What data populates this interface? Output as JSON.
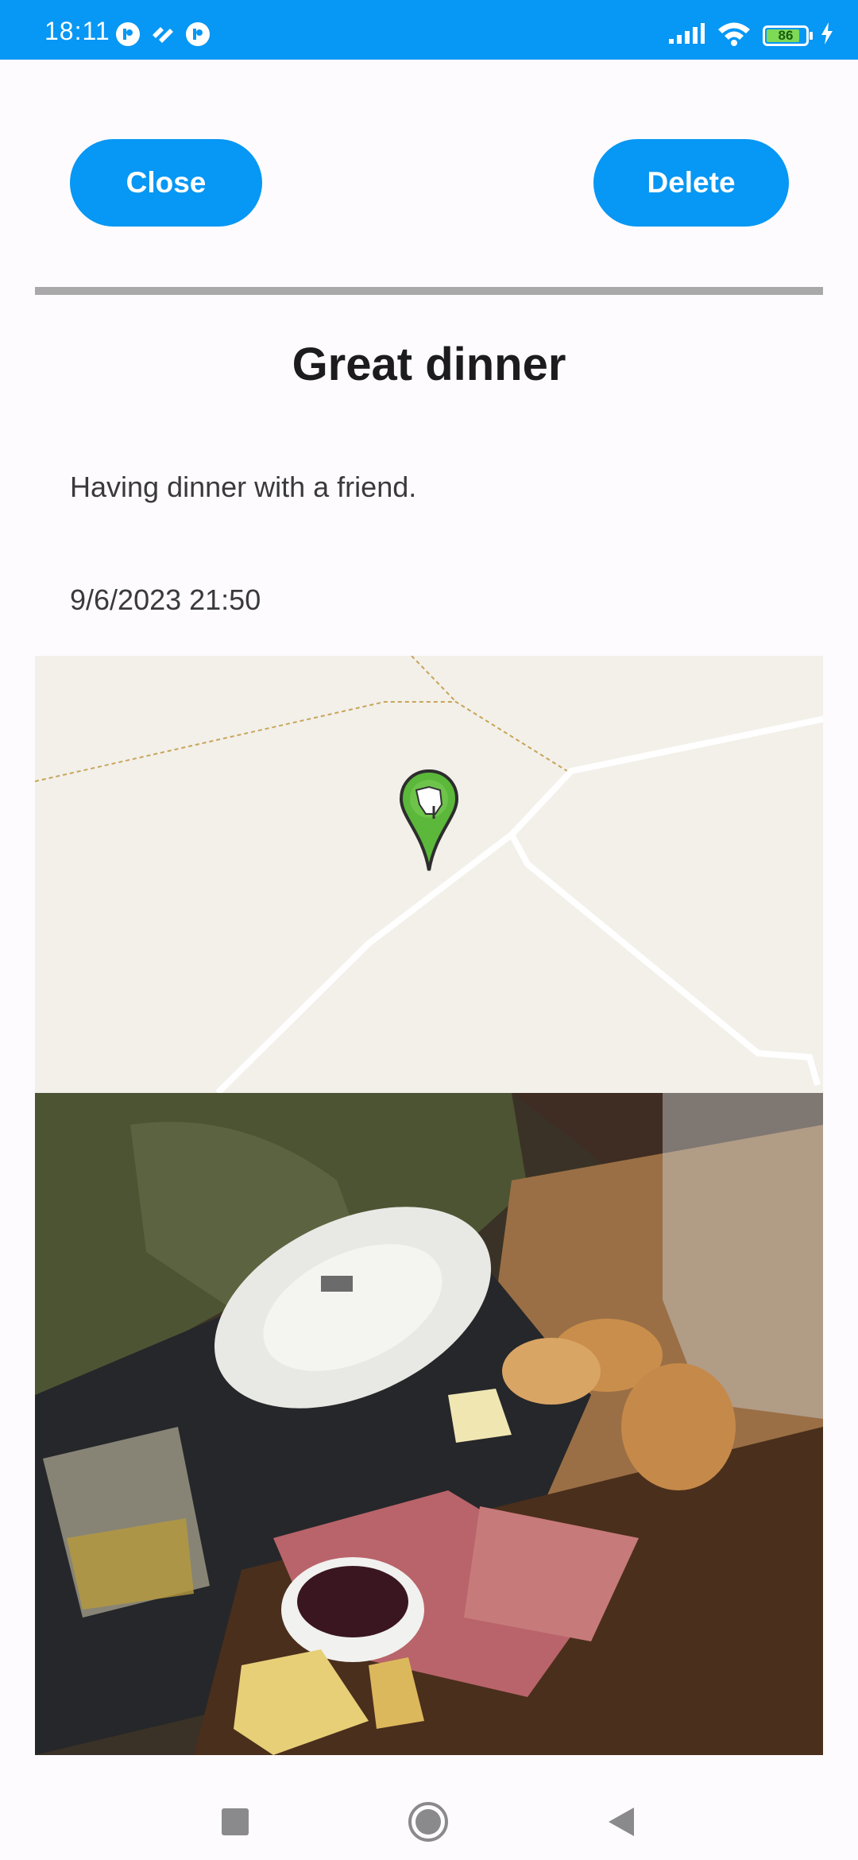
{
  "status_bar": {
    "time": "18:11",
    "battery_level": "86",
    "battery_fraction": 0.86,
    "icons": [
      "app-notification-icon",
      "app-notification-icon",
      "app-notification-icon",
      "signal-icon",
      "wifi-icon",
      "battery-icon",
      "charging-icon"
    ]
  },
  "toolbar": {
    "close_label": "Close",
    "delete_label": "Delete"
  },
  "entry": {
    "title": "Great dinner",
    "description": "Having dinner with a friend.",
    "datetime": "9/6/2023 21:50"
  },
  "map": {
    "marker_icon": "map-pin-icon",
    "marker_color": "#5cb83a"
  },
  "photo": {
    "subject": "food-photo"
  },
  "colors": {
    "accent": "#0797f4",
    "divider": "#a9a9a9",
    "map_background": "#f2f0e9"
  },
  "nav_bar": {
    "icons": [
      "recents-icon",
      "home-icon",
      "back-icon"
    ]
  }
}
